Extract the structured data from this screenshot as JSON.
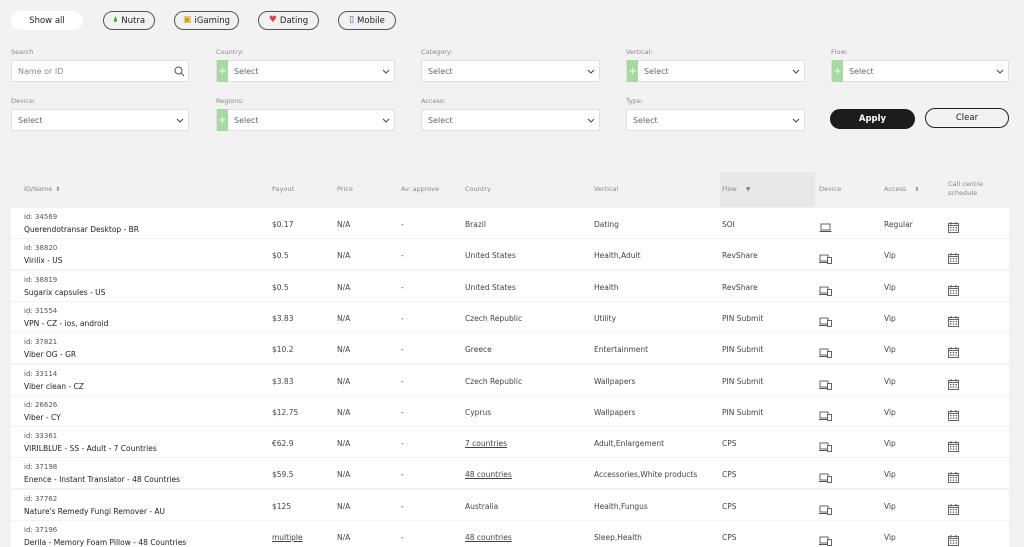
{
  "chips": [
    {
      "label": "Show all",
      "icon": "",
      "active": true
    },
    {
      "label": "Nutra",
      "icon": "nutra-icon"
    },
    {
      "label": "iGaming",
      "icon": "igaming-icon"
    },
    {
      "label": "Dating",
      "icon": "dating-icon"
    },
    {
      "label": "Mobile",
      "icon": "mobile-icon"
    }
  ],
  "filters": {
    "search_label": "Search",
    "search_placeholder": "Name or ID",
    "country_label": "Country:",
    "category_label": "Category:",
    "vertical_label": "Vertical:",
    "flow_label": "Flow:",
    "device_label": "Device:",
    "regions_label": "Regions:",
    "access_label": "Access:",
    "type_label": "Type:",
    "select_text": "Select"
  },
  "buttons": {
    "apply": "Apply",
    "clear": "Clear"
  },
  "table": {
    "headers": {
      "id_name": "ID/Name",
      "payout": "Payout",
      "price": "Price",
      "approve": "Av. approve",
      "country": "Country",
      "vertical": "Vertical",
      "flow": "Flow",
      "device": "Device",
      "access": "Access",
      "callcentre": "Call centre schedule"
    },
    "rows": [
      {
        "id": "id: 34569",
        "name": "Querendotransar Desktop - BR",
        "payout": "$0.17",
        "price": "N/A",
        "approve": "-",
        "country": "Brazil",
        "vertical": "Dating",
        "flow": "SOI",
        "device": "desktop",
        "access": "Regular"
      },
      {
        "id": "id: 38820",
        "name": "Virilix - US",
        "payout": "$0.5",
        "price": "N/A",
        "approve": "-",
        "country": "United States",
        "vertical": "Health,Adult",
        "flow": "RevShare",
        "device": "multi",
        "access": "Vip"
      },
      {
        "id": "id: 38819",
        "name": "Sugarix capsules - US",
        "payout": "$0.5",
        "price": "N/A",
        "approve": "-",
        "country": "United States",
        "vertical": "Health",
        "flow": "RevShare",
        "device": "multi",
        "access": "Vip"
      },
      {
        "id": "id: 31554",
        "name": "VPN - CZ - ios, android",
        "payout": "$3.83",
        "price": "N/A",
        "approve": "-",
        "country": "Czech Republic",
        "vertical": "Utility",
        "flow": "PIN Submit",
        "device": "multi",
        "access": "Vip"
      },
      {
        "id": "id: 37821",
        "name": "Viber OG - GR",
        "payout": "$10.2",
        "price": "N/A",
        "approve": "-",
        "country": "Greece",
        "vertical": "Entertainment",
        "flow": "PIN Submit",
        "device": "multi",
        "access": "Vip"
      },
      {
        "id": "id: 33114",
        "name": "Viber clean - CZ",
        "payout": "$3.83",
        "price": "N/A",
        "approve": "-",
        "country": "Czech Republic",
        "vertical": "Wallpapers",
        "flow": "PIN Submit",
        "device": "multi",
        "access": "Vip"
      },
      {
        "id": "id: 26626",
        "name": "Viber - CY",
        "payout": "$12.75",
        "price": "N/A",
        "approve": "-",
        "country": "Cyprus",
        "vertical": "Wallpapers",
        "flow": "PIN Submit",
        "device": "multi",
        "access": "Vip"
      },
      {
        "id": "id: 33361",
        "name": "VIRILBLUE - SS - Adult - 7 Countries",
        "payout": "€62.9",
        "price": "N/A",
        "approve": "-",
        "country": "7 countries",
        "country_link": true,
        "vertical": "Adult,Enlargement",
        "flow": "CPS",
        "device": "multi",
        "access": "Vip"
      },
      {
        "id": "id: 37198",
        "name": "Enence - Instant Translator - 48 Countries",
        "payout": "$59.5",
        "price": "N/A",
        "approve": "-",
        "country": "48 countries",
        "country_link": true,
        "vertical": "Accessories,White products",
        "flow": "CPS",
        "device": "multi",
        "access": "Vip"
      },
      {
        "id": "id: 37762",
        "name": "Nature's Remedy Fungi Remover - AU",
        "payout": "$125",
        "price": "N/A",
        "approve": "-",
        "country": "Australia",
        "vertical": "Health,Fungus",
        "flow": "CPS",
        "device": "multi",
        "access": "Vip"
      },
      {
        "id": "id: 37196",
        "name": "Derila - Memory Foam Pillow - 48 Countries",
        "payout": "multiple",
        "payout_link": true,
        "price": "N/A",
        "approve": "-",
        "country": "48 countries",
        "country_link": true,
        "vertical": "Sleep,Health",
        "flow": "CPS",
        "device": "multi",
        "access": "Vip"
      }
    ]
  }
}
